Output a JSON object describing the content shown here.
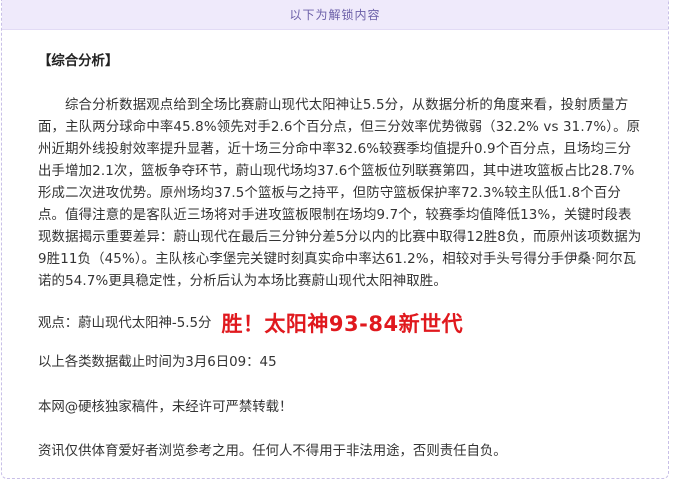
{
  "unlock_bar": {
    "text": "以下为解锁内容"
  },
  "article": {
    "section_title": "【综合分析】",
    "analysis_text": "综合分析数据观点给到全场比赛蔚山现代太阳神让5.5分，从数据分析的角度来看，投射质量方面，主队两分球命中率45.8%领先对手2.6个百分点，但三分效率优势微弱（32.2% vs 31.7%）。原州近期外线投射效率提升显著，近十场三分命中率32.6%较赛季均值提升0.9个百分点，且场均三分出手增加2.1次，篮板争夺环节，蔚山现代场均37.6个篮板位列联赛第四，其中进攻篮板占比28.7%形成二次进攻优势。原州场均37.5个篮板与之持平，但防守篮板保护率72.3%较主队低1.8个百分点。值得注意的是客队近三场将对手进攻篮板限制在场均9.7个，较赛季均值降低13%，关键时段表现数据揭示重要差异：蔚山现代在最后三分钟分差5分以内的比赛中取得12胜8负，而原州该项数据为9胜11负（45%）。主队核心李堡完关键时刻真实命中率达61.2%，相较对手头号得分手伊桑·阿尔瓦诺的54.7%更具稳定性，分析后认为本场比赛蔚山现代太阳神取胜。",
    "viewpoint_label": "观点：蔚山现代太阳神-5.5分",
    "viewpoint_result": "胜！太阳神93-84新世代",
    "cutoff_text": "以上各类数据截止时间为3月6日09：45",
    "copyright_text": "本网@硬核独家稿件，未经许可严禁转载！",
    "disclaimer_text": "资讯仅供体育爱好者浏览参考之用。任何人不得用于非法用途，否则责任自负。"
  },
  "colors": {
    "unlock_bar_bg": "#efeafb",
    "unlock_bar_text": "#6b5fa8",
    "result_red": "#e0191e",
    "body_text": "#333333"
  }
}
